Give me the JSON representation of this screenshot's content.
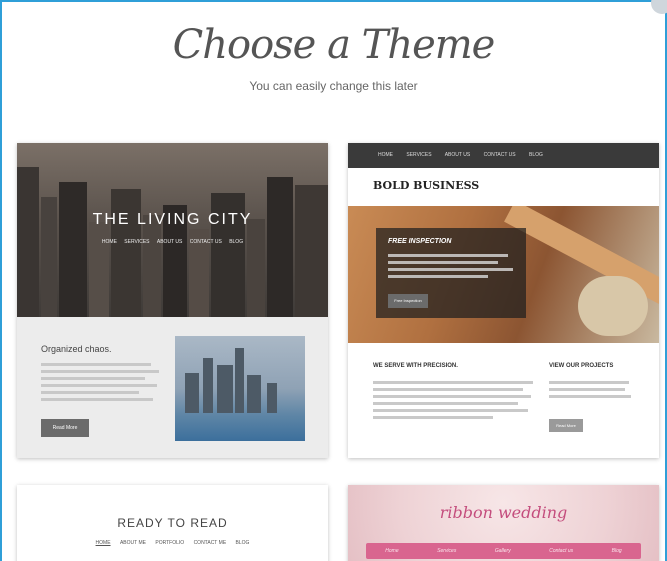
{
  "header": {
    "title": "Choose a Theme",
    "subtitle": "You can easily change this later"
  },
  "themes": [
    {
      "name": "THE LIVING CITY",
      "nav": [
        "HOME",
        "SERVICES",
        "ABOUT US",
        "CONTACT US",
        "BLOG"
      ],
      "body_title": "Organized chaos.",
      "button": "Read More"
    },
    {
      "name": "BOLD BUSINESS",
      "nav": [
        "HOME",
        "SERVICES",
        "ABOUT US",
        "CONTACT US",
        "BLOG"
      ],
      "overlay_title": "FREE INSPECTION",
      "overlay_button": "Free Inspection",
      "col1_title": "WE SERVE WITH PRECISION.",
      "col2_title": "VIEW OUR PROJECTS",
      "button": "Read More"
    },
    {
      "name": "READY TO READ",
      "nav": [
        "HOME",
        "ABOUT ME",
        "PORTFOLIO",
        "CONTACT ME",
        "BLOG"
      ]
    },
    {
      "name": "ribbon wedding",
      "nav": [
        "Home",
        "Services",
        "Gallery",
        "Contact us",
        "Blog"
      ]
    }
  ],
  "colors": {
    "frame_border": "#2f9fd8",
    "ribbon_accent": "#d9658f"
  }
}
